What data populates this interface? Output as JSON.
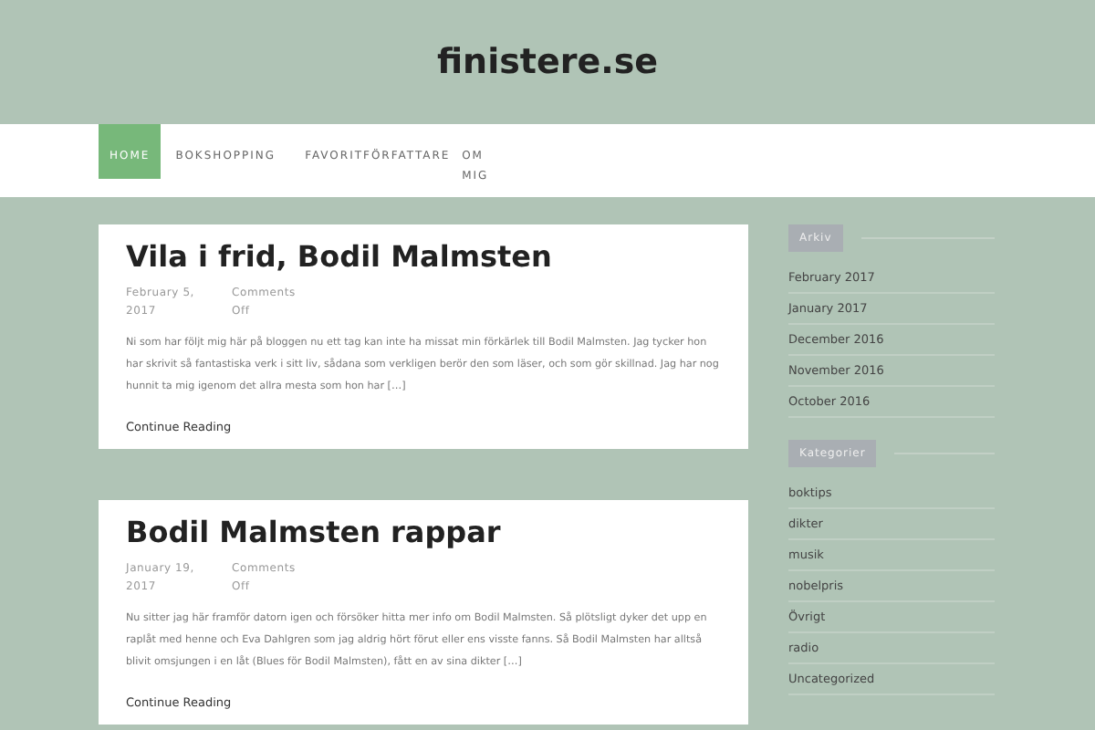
{
  "site_title": "finistere.se",
  "nav": [
    {
      "label": "HOME",
      "selected": true
    },
    {
      "label": "BOKSHOPPING",
      "selected": false
    },
    {
      "label": "FAVORITFÖRFATTARE",
      "selected": false
    },
    {
      "label": "OM MIG",
      "selected": false
    }
  ],
  "posts": [
    {
      "title": "Vila i frid, Bodil Malmsten",
      "date": "February 5, 2017",
      "comments": "Comments Off",
      "excerpt": "Ni som har följt mig här på bloggen nu ett tag kan inte ha missat min förkärlek till Bodil Malmsten. Jag tycker hon har skrivit så fantastiska verk i sitt liv, sådana som verkligen berör den som läser, och som gör skillnad. Jag har nog hunnit ta mig igenom det allra mesta som hon har […]",
      "more": "Continue Reading"
    },
    {
      "title": "Bodil Malmsten rappar",
      "date": "January 19, 2017",
      "comments": "Comments Off",
      "excerpt": "Nu sitter jag här framför datorn igen och försöker hitta mer info om Bodil Malmsten. Så plötsligt dyker det upp en raplåt med henne och Eva Dahlgren som jag aldrig hört förut eller ens visste fanns. Så Bodil Malmsten har alltså blivit omsjungen i en låt (Blues för Bodil Malmsten), fått en av sina dikter […]",
      "more": "Continue Reading"
    }
  ],
  "widgets": [
    {
      "title": "Arkiv",
      "items": [
        "February 2017",
        "January 2017",
        "December 2016",
        "November 2016",
        "October 2016"
      ]
    },
    {
      "title": "Kategorier",
      "items": [
        "boktips",
        "dikter",
        "musik",
        "nobelpris",
        "Övrigt",
        "radio",
        "Uncategorized"
      ]
    }
  ]
}
